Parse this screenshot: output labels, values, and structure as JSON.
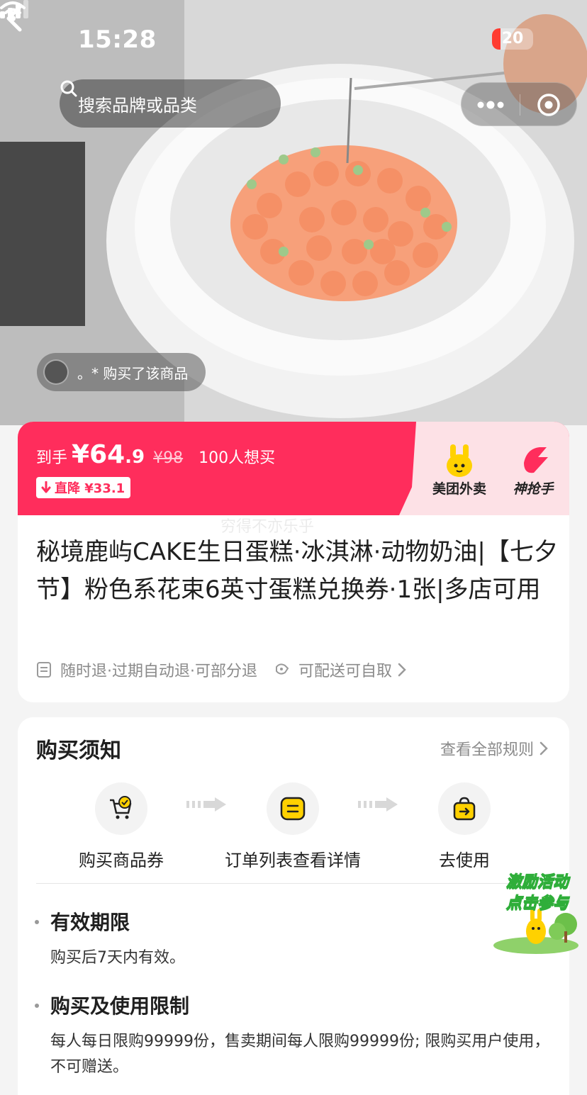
{
  "status_bar": {
    "time": "15:28",
    "battery": "20"
  },
  "nav": {
    "search_placeholder": "搜索品牌或品类"
  },
  "hero": {
    "buyer_notice": "。* 购买了该商品"
  },
  "price": {
    "label": "到手",
    "main": "¥64",
    "decimal": ".9",
    "original": "¥98",
    "want_count": "100人想买",
    "drop_label": "直降 ¥33.1"
  },
  "brands": {
    "meituan": "美团外卖",
    "grab": "神抢手"
  },
  "watermark": "穷得不亦乐乎",
  "product": {
    "title": "秘境鹿屿CAKE生日蛋糕·冰淇淋·动物奶油|【七夕节】粉色系花束6英寸蛋糕兑换券·1张|多店可用",
    "refund_tag": "随时退·过期自动退·可部分退",
    "delivery_tag": "可配送可自取"
  },
  "notice": {
    "title": "购买须知",
    "view_all": "查看全部规则",
    "steps": [
      {
        "label": "购买商品券",
        "icon": "cart-check-icon"
      },
      {
        "label": "订单列表查看详情",
        "icon": "order-list-icon"
      },
      {
        "label": "去使用",
        "icon": "use-bag-icon"
      }
    ],
    "rules": [
      {
        "title": "有效期限",
        "body": "购买后7天内有效。"
      },
      {
        "title": "购买及使用限制",
        "body": "每人每日限购99999份，售卖期间每人限购99999份; 限购买用户使用，不可赠送。"
      }
    ]
  },
  "promo": {
    "line1": "激励活动",
    "line2": "点击参与"
  },
  "colors": {
    "accent": "#ff2d5c",
    "brand_yellow": "#ffd100"
  }
}
